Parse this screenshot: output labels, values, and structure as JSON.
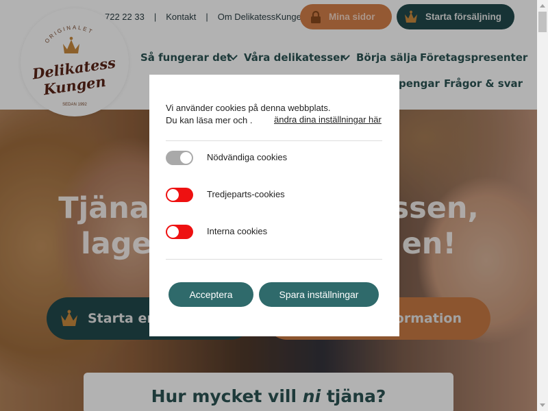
{
  "header": {
    "phone_partial": "722 22 33",
    "separator": "|",
    "contact_label": "Kontakt",
    "about_label": "Om DelikatessKungen",
    "my_pages_label": "Mina sidor",
    "start_sales_label": "Starta försäljning",
    "logo": {
      "arc_text": "ORIGINALET",
      "name_line1": "Delikatess",
      "name_line2": "Kungen",
      "since": "SEDAN 1992"
    }
  },
  "nav": {
    "row1": [
      "Så fungerar det",
      "Våra delikatesser",
      "Börja sälja",
      "Företagspresenter"
    ],
    "row2_partial": "pengar",
    "row2_last": "Frågor & svar"
  },
  "hero": {
    "headline_line1": "Tjäna pengar till klassen,",
    "headline_line2": "laget eller föreningen!",
    "start_button": "Starta en försäljning",
    "info_button": "Mer information"
  },
  "calculator": {
    "title_before": "Hur mycket vill ",
    "title_em": "ni",
    "title_after": " tjäna?"
  },
  "cookie_dialog": {
    "intro_line1": "Vi använder cookies på denna webbplats.",
    "intro_line2": "Du kan läsa mer och .",
    "settings_link": "ändra dina inställningar här",
    "toggles": [
      {
        "label": "Nödvändiga cookies",
        "state": "on-disabled"
      },
      {
        "label": "Tredjeparts-cookies",
        "state": "off"
      },
      {
        "label": "Interna cookies",
        "state": "off"
      }
    ],
    "accept_label": "Acceptera",
    "save_label": "Spara inställningar"
  },
  "colors": {
    "teal_dark": "#214a4c",
    "teal_button": "#2f6a6b",
    "orange": "#d4804a",
    "toggle_off_red": "#ee1111",
    "toggle_on_gray": "#a9a9a9"
  }
}
